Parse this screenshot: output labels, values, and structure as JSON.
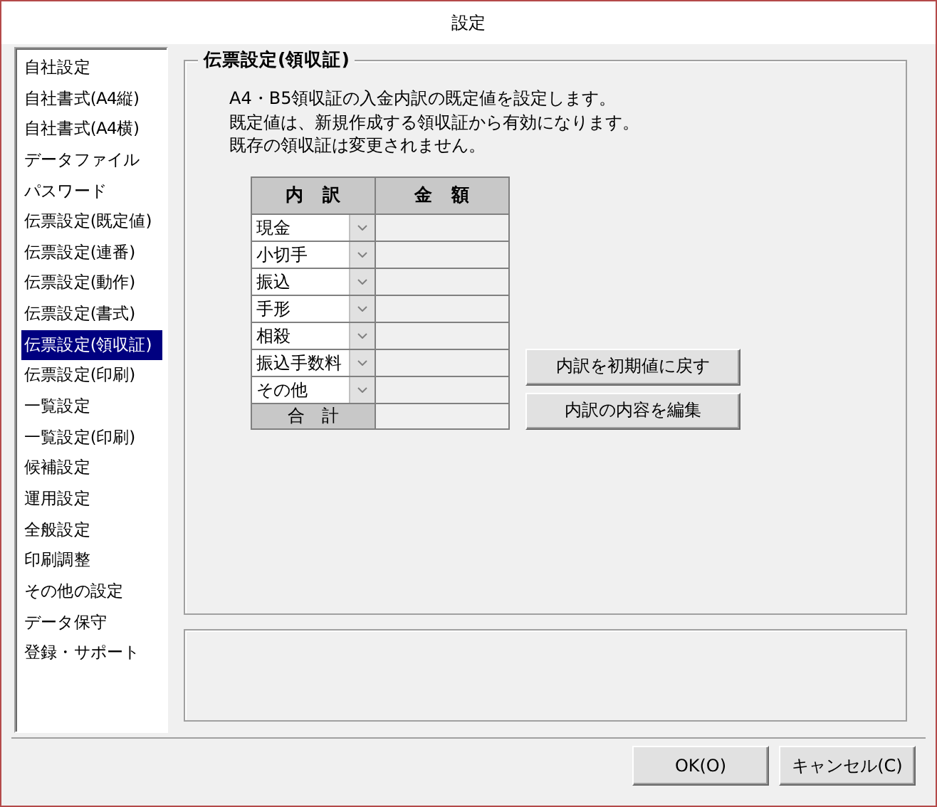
{
  "window": {
    "title": "設定"
  },
  "sidebar": {
    "items": [
      {
        "label": "自社設定",
        "selected": false
      },
      {
        "label": "自社書式(A4縦)",
        "selected": false
      },
      {
        "label": "自社書式(A4横)",
        "selected": false
      },
      {
        "label": "データファイル",
        "selected": false
      },
      {
        "label": "パスワード",
        "selected": false
      },
      {
        "label": "伝票設定(既定値)",
        "selected": false
      },
      {
        "label": "伝票設定(連番)",
        "selected": false
      },
      {
        "label": "伝票設定(動作)",
        "selected": false
      },
      {
        "label": "伝票設定(書式)",
        "selected": false
      },
      {
        "label": "伝票設定(領収証)",
        "selected": true
      },
      {
        "label": "伝票設定(印刷)",
        "selected": false
      },
      {
        "label": "一覧設定",
        "selected": false
      },
      {
        "label": "一覧設定(印刷)",
        "selected": false
      },
      {
        "label": "候補設定",
        "selected": false
      },
      {
        "label": "運用設定",
        "selected": false
      },
      {
        "label": "全般設定",
        "selected": false
      },
      {
        "label": "印刷調整",
        "selected": false
      },
      {
        "label": "その他の設定",
        "selected": false
      },
      {
        "label": "データ保守",
        "selected": false
      },
      {
        "label": "登録・サポート",
        "selected": false
      }
    ]
  },
  "panel": {
    "title": "伝票設定(領収証)",
    "description": [
      "A4・B5領収証の入金内訳の既定値を設定します。",
      "既定値は、新規作成する領収証から有効になります。",
      "既存の領収証は変更されません。"
    ],
    "table": {
      "columns": [
        "内　訳",
        "金　額"
      ],
      "rows": [
        {
          "item": "現金"
        },
        {
          "item": "小切手"
        },
        {
          "item": "振込"
        },
        {
          "item": "手形"
        },
        {
          "item": "相殺"
        },
        {
          "item": "振込手数料"
        },
        {
          "item": "その他"
        }
      ],
      "total_label": "合　計"
    },
    "buttons": [
      "内訳を初期値に戻す",
      "内訳の内容を編集"
    ]
  },
  "footer": {
    "buttons": [
      "OK(O)",
      "キャンセル(C)"
    ]
  }
}
